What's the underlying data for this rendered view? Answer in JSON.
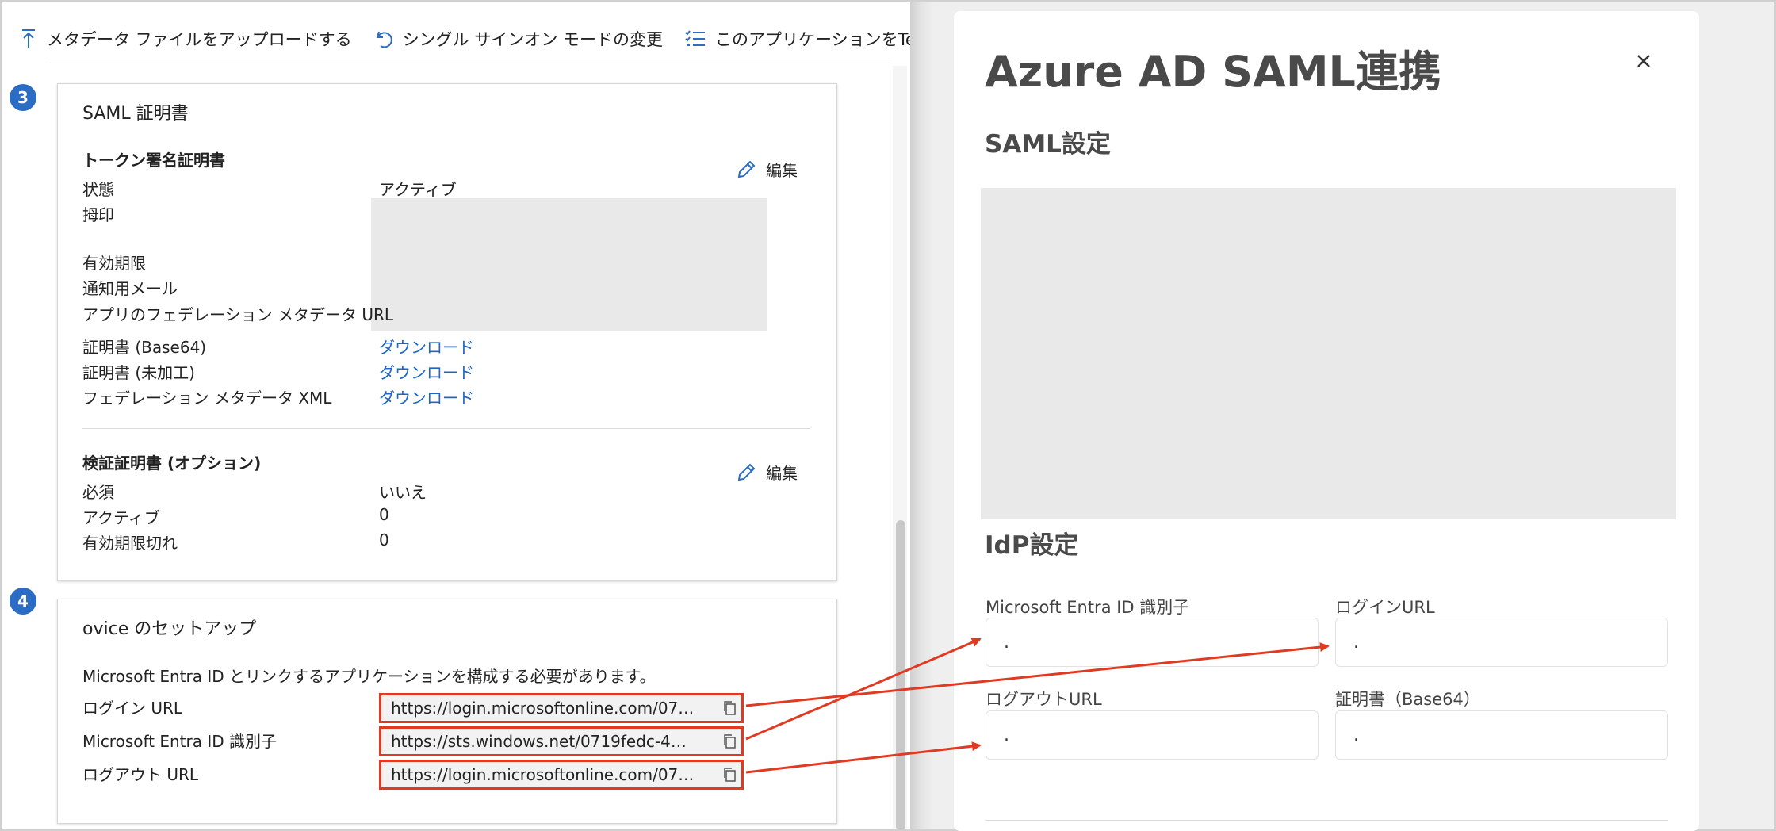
{
  "toolbar": {
    "upload_label": "メタデータ ファイルをアップロードする",
    "sso_mode_label": "シングル サインオン モードの変更",
    "test_label": "このアプリケーションをTest",
    "more_label": "···"
  },
  "saml_cert": {
    "step": "3",
    "title": "SAML 証明書",
    "token_section": "トークン署名証明書",
    "edit_label": "編集",
    "status_label": "状態",
    "status_value": "アクティブ",
    "thumbprint_label": "拇印",
    "expiry_label": "有効期限",
    "notify_label": "通知用メール",
    "metadata_url_label": "アプリのフェデレーション メタデータ URL",
    "cert_base64_label": "証明書 (Base64)",
    "cert_raw_label": "証明書 (未加工)",
    "fed_xml_label": "フェデレーション メタデータ XML",
    "download_label": "ダウンロード",
    "verify_section": "検証証明書 (オプション)",
    "required_label": "必須",
    "required_value": "いいえ",
    "active_label": "アクティブ",
    "active_value": "0",
    "expired_label": "有効期限切れ",
    "expired_value": "0"
  },
  "setup": {
    "step": "4",
    "title": "ovice のセットアップ",
    "description": "Microsoft Entra ID とリンクするアプリケーションを構成する必要があります。",
    "login_url_label": "ログイン URL",
    "login_url_value": "https://login.microsoftonline.com/07…",
    "entra_id_label": "Microsoft Entra ID 識別子",
    "entra_id_value": "https://sts.windows.net/0719fedc-4…",
    "logout_url_label": "ログアウト URL",
    "logout_url_value": "https://login.microsoftonline.com/07…"
  },
  "panel": {
    "title": "Azure AD SAML連携",
    "saml_section": "SAML設定",
    "idp_section": "IdP設定",
    "fields": {
      "entra_id_label": "Microsoft Entra ID 識別子",
      "entra_id_value": ".",
      "login_url_label": "ログインURL",
      "login_url_value": ".",
      "logout_url_label": "ログアウトURL",
      "logout_url_value": ".",
      "cert_label": "証明書（Base64）",
      "cert_value": "."
    }
  },
  "colors": {
    "accent_blue": "#2b6cc4",
    "link_blue": "#1a66c9",
    "highlight_red": "#e03a22"
  }
}
